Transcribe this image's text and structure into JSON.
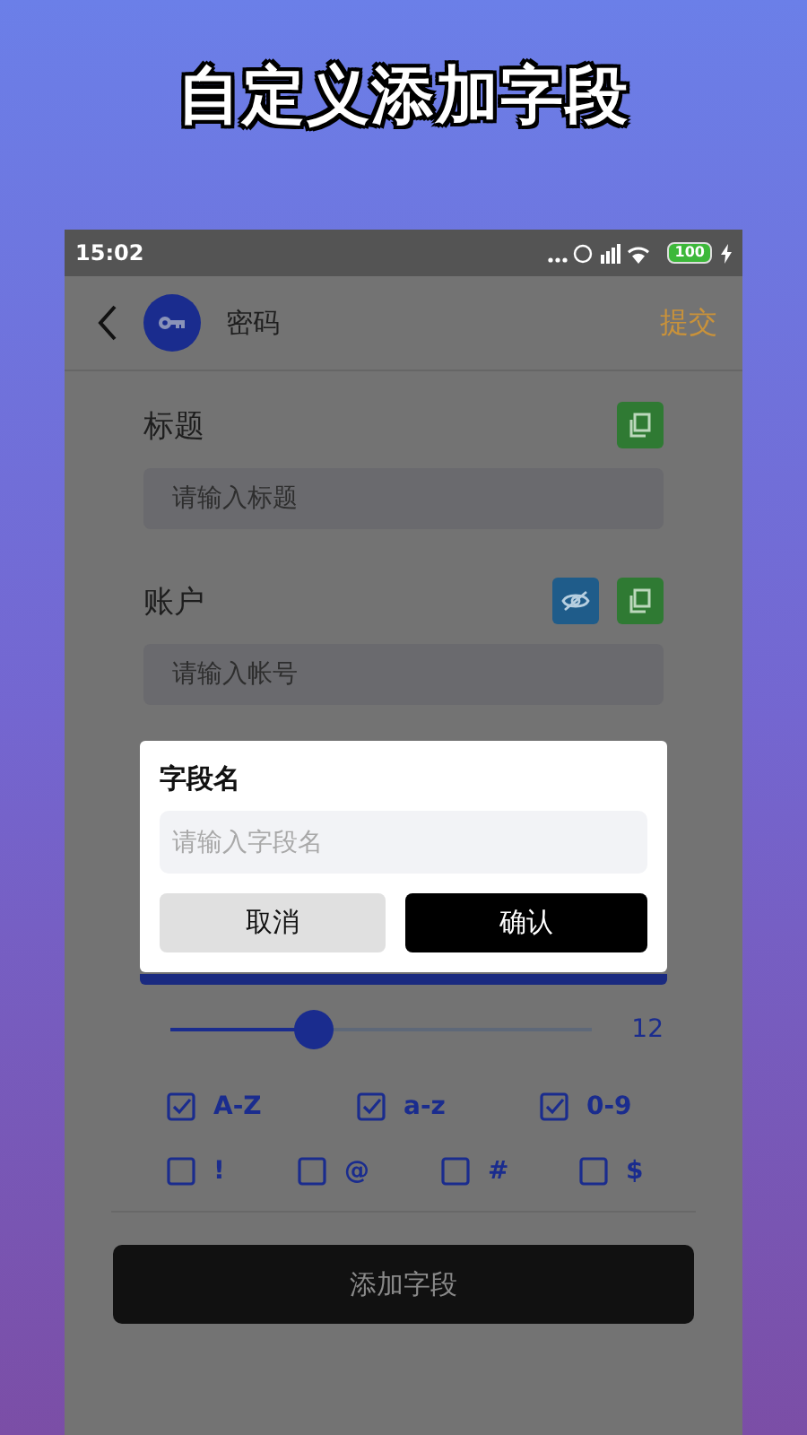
{
  "headline": "自定义添加字段",
  "status_bar": {
    "time": "15:02",
    "battery": "100"
  },
  "app_bar": {
    "title": "密码",
    "action": "提交"
  },
  "fields": [
    {
      "label": "标题",
      "placeholder": "请输入标题",
      "kind": "plain"
    },
    {
      "label": "账户",
      "placeholder": "请输入帐号",
      "kind": "secret"
    }
  ],
  "generator": {
    "level": 0.34,
    "length": "12",
    "options": [
      {
        "label": "A-Z",
        "checked": true
      },
      {
        "label": "a-z",
        "checked": true
      },
      {
        "label": "0-9",
        "checked": true
      },
      {
        "label": "!",
        "checked": false
      },
      {
        "label": "@",
        "checked": false
      },
      {
        "label": "#",
        "checked": false
      },
      {
        "label": "$",
        "checked": false
      }
    ]
  },
  "add_button": "添加字段",
  "dialog": {
    "title": "字段名",
    "placeholder": "请输入字段名",
    "cancel": "取消",
    "confirm": "确认"
  }
}
